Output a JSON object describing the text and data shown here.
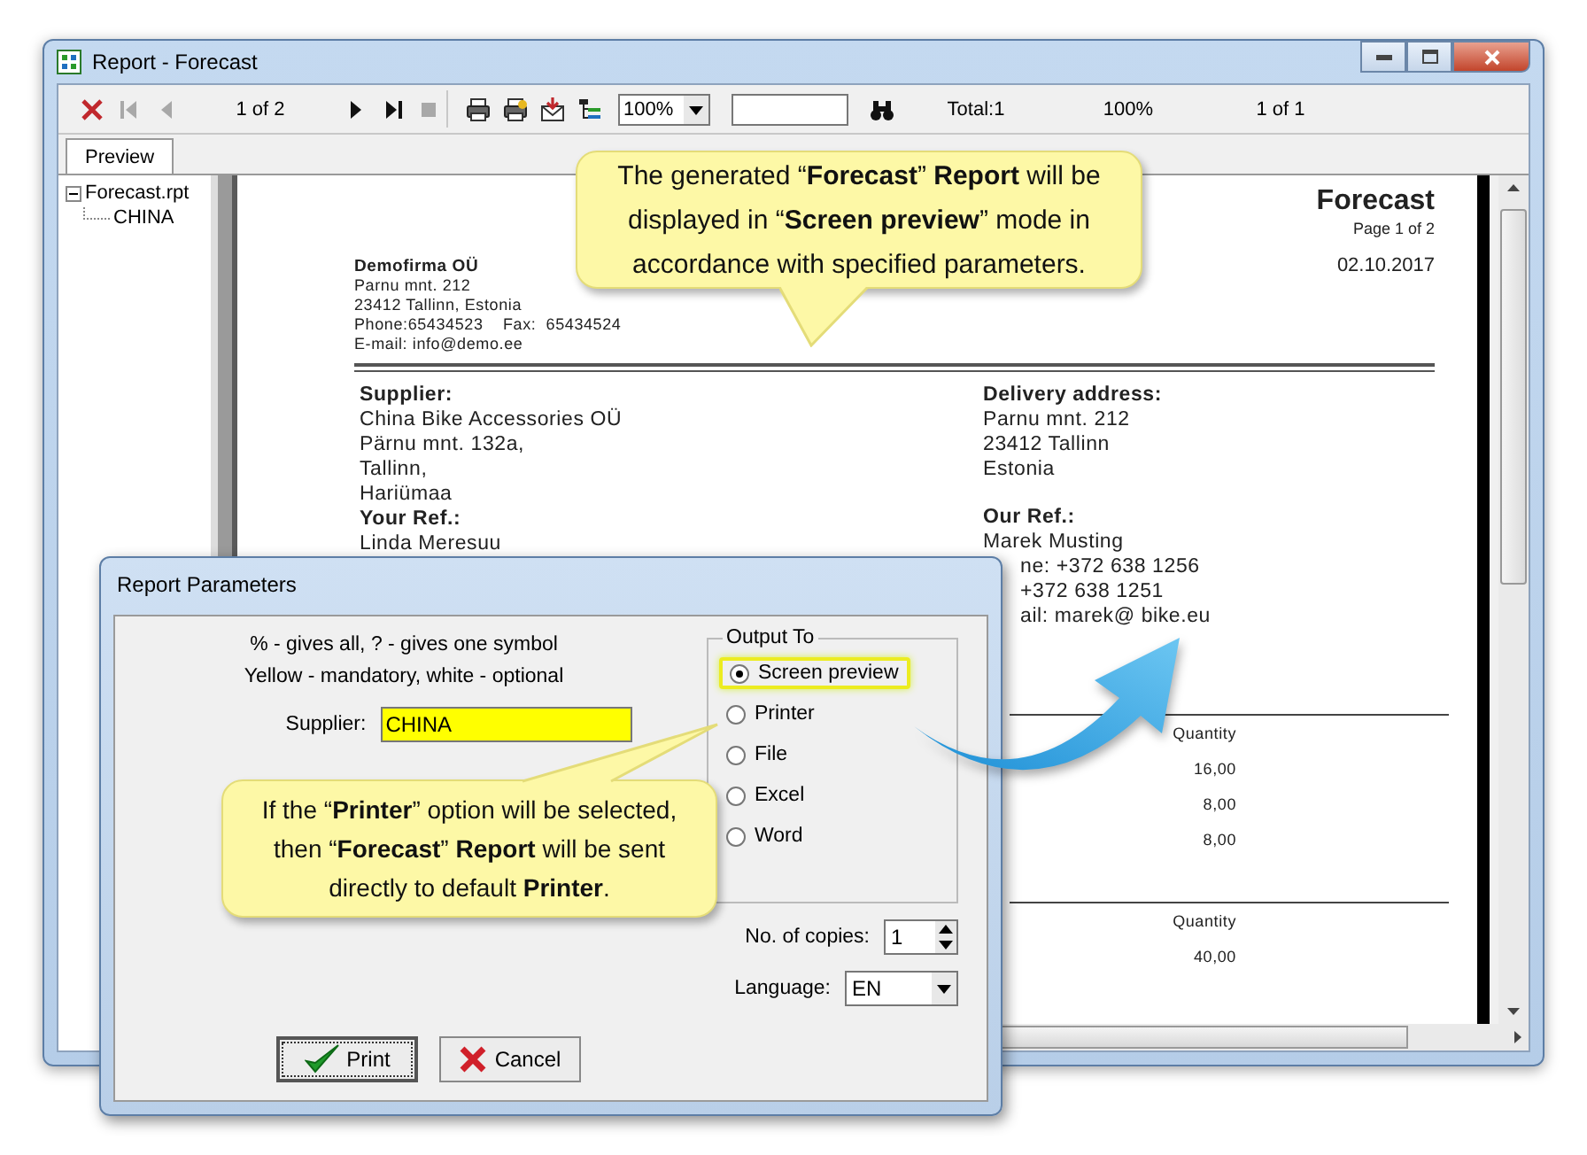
{
  "window": {
    "title": "Report - Forecast"
  },
  "toolbar": [
    {
      "kind": "close",
      "disabled": false
    },
    {
      "kind": "first",
      "disabled": true
    },
    {
      "kind": "prev",
      "disabled": true
    },
    {
      "kind": "text",
      "text": "1 of 2"
    },
    {
      "kind": "next",
      "disabled": false
    },
    {
      "kind": "last",
      "disabled": false
    },
    {
      "kind": "stop",
      "disabled": true
    },
    {
      "kind": "print"
    },
    {
      "kind": "print_setup"
    },
    {
      "kind": "export"
    },
    {
      "kind": "tree"
    },
    {
      "kind": "zoom",
      "value": "100%"
    },
    {
      "kind": "search"
    },
    {
      "kind": "find",
      "disabled": false
    },
    {
      "kind": "text",
      "text": "Total:1"
    },
    {
      "kind": "text",
      "text": "100%"
    },
    {
      "kind": "text",
      "text": "1 of 1"
    }
  ],
  "tabs": [
    {
      "label": "Preview",
      "selected": true
    }
  ],
  "tree": [
    {
      "label": "Forecast.rpt",
      "expanded": true,
      "children": [
        {
          "label": "CHINA"
        }
      ]
    }
  ],
  "report": {
    "title": "Forecast",
    "page": "Page 1 of 2",
    "date": "02.10.2017",
    "company": {
      "name": "Demofirma OÜ",
      "lines": [
        "Parnu mnt. 212",
        "23412 Tallinn, Estonia",
        "Phone:65434523    Fax:  65434524",
        "E-mail: info@demo.ee"
      ]
    },
    "left": [
      {
        "label": "Supplier:",
        "lines": [
          "China Bike Accessories OÜ",
          "Pärnu mnt. 132a,",
          "Tallinn,",
          "Hariümaa"
        ]
      },
      {
        "label": "Your Ref.:",
        "lines": [
          "Linda Meresuu"
        ]
      }
    ],
    "right": [
      {
        "label": "Delivery address:",
        "lines": [
          "Parnu mnt. 212",
          "23412 Tallinn",
          "Estonia"
        ]
      },
      {
        "label": "Our Ref.:",
        "lines": [
          "Marek Musting"
        ],
        "lines_behind_dialog": [
          "ne: +372 638 1256",
          "+372 638 1251",
          "ail: marek@ bike.eu"
        ]
      }
    ],
    "tables": [
      {
        "heading": "Quantity",
        "values": [
          "16,00",
          "8,00",
          "8,00"
        ]
      },
      {
        "heading": "Quantity",
        "values": [
          "40,00"
        ]
      }
    ]
  },
  "dialog": {
    "title": "Report Parameters",
    "hints": [
      "% - gives all, ? - gives one symbol",
      "Yellow - mandatory, white - optional"
    ],
    "supplier": {
      "label": "Supplier:",
      "value": "CHINA",
      "mandatory": true
    },
    "output": {
      "title": "Output To",
      "options": [
        {
          "label": "Screen preview",
          "selected": true,
          "highlighted": true
        },
        {
          "label": "Printer",
          "selected": false,
          "highlighted": false
        },
        {
          "label": "File",
          "selected": false,
          "highlighted": false
        },
        {
          "label": "Excel",
          "selected": false,
          "highlighted": false
        },
        {
          "label": "Word",
          "selected": false,
          "highlighted": false
        }
      ]
    },
    "copies": {
      "label": "No. of copies:",
      "value": "1"
    },
    "language": {
      "label": "Language:",
      "value": "EN"
    },
    "buttons": [
      {
        "label": "Print",
        "kind": "ok",
        "default": true
      },
      {
        "label": "Cancel",
        "kind": "cancel",
        "default": false
      }
    ]
  },
  "callouts": [
    "The generated “**Forecast**” **Report** will be displayed in “**Screen preview**” mode in accordance with specified parameters.",
    "If the “**Printer**” option will be selected, then “**Forecast**” **Report** will be sent directly to default **Printer**."
  ]
}
